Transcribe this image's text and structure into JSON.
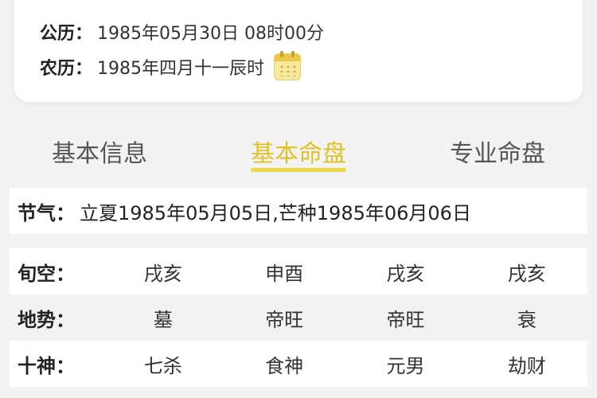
{
  "info_card": {
    "solar_label": "公历：",
    "solar_value": "1985年05月30日 08时00分",
    "lunar_label": "农历：",
    "lunar_value": "1985年四月十一辰时"
  },
  "tabs": [
    {
      "label": "基本信息",
      "active": false
    },
    {
      "label": "基本命盘",
      "active": true
    },
    {
      "label": "专业命盘",
      "active": false
    }
  ],
  "accent_color": "#f0d846",
  "jieqi": {
    "label": "节气：",
    "value": "立夏1985年05月05日,芒种1985年06月06日"
  },
  "table": {
    "rows": [
      {
        "label": "旬空：",
        "cells": [
          "戌亥",
          "申酉",
          "戌亥",
          "戌亥"
        ]
      },
      {
        "label": "地势：",
        "cells": [
          "墓",
          "帝旺",
          "帝旺",
          "衰"
        ]
      },
      {
        "label": "十神：",
        "cells": [
          "七杀",
          "食神",
          "元男",
          "劫财"
        ]
      }
    ]
  },
  "icons": {
    "calendar": "calendar-icon"
  }
}
